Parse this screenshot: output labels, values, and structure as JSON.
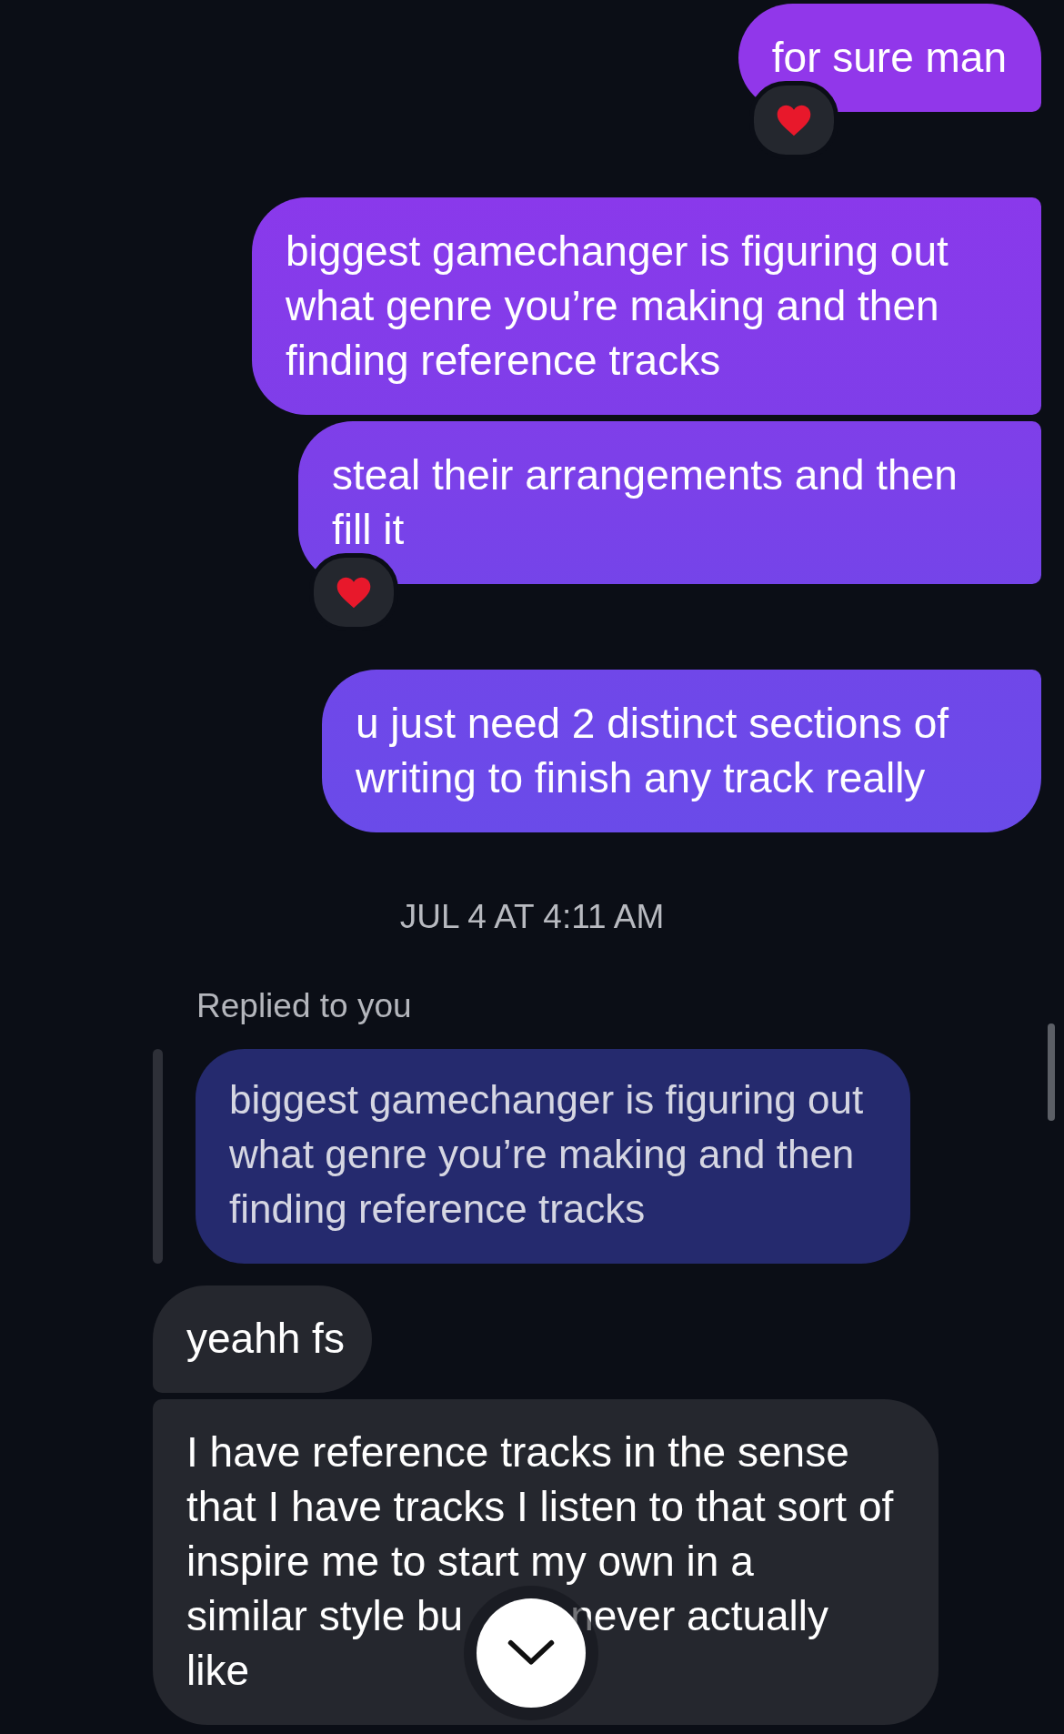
{
  "messages": [
    {
      "kind": "outgoing",
      "text": "for sure man",
      "reacted": true
    },
    {
      "kind": "outgoing",
      "text": "biggest gamechanger is figuring out what genre you’re making and then finding reference tracks",
      "reacted": false
    },
    {
      "kind": "outgoing",
      "text": "steal their arrangements and then fill it",
      "reacted": true
    },
    {
      "kind": "outgoing",
      "text": "u just need 2 distinct sections of writing to finish any track really",
      "reacted": false
    },
    {
      "kind": "timestamp",
      "text": "JUL 4 AT 4:11 AM"
    },
    {
      "kind": "reply_label",
      "text": "Replied to you"
    },
    {
      "kind": "quote",
      "text": "biggest gamechanger is figuring out what genre you’re making and then finding reference tracks"
    },
    {
      "kind": "incoming",
      "text": "yeahh fs"
    },
    {
      "kind": "incoming",
      "text": "I have reference tracks in the sense that I have tracks I listen to that sort of inspire me to start my own in a",
      "covered_rows": [
        [
          "similar style bu",
          "never actually"
        ],
        [
          "like"
        ]
      ]
    }
  ]
}
